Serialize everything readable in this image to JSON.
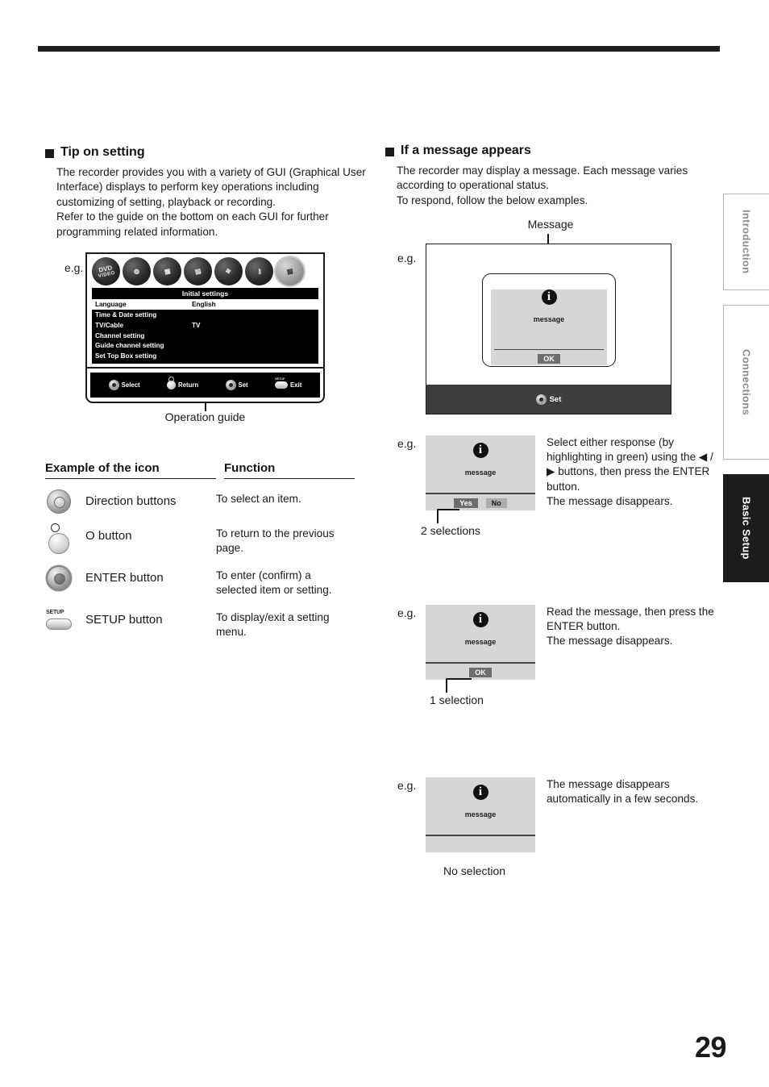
{
  "page": {
    "number": "29"
  },
  "side_tabs": [
    {
      "label": "Introduction",
      "active": false
    },
    {
      "label": "Connections",
      "active": false
    },
    {
      "label": "Basic Setup",
      "active": true
    }
  ],
  "left_column": {
    "heading": "Tip on setting",
    "paragraphs": [
      "The recorder provides you with a variety of GUI (Graphical User Interface) displays to perform key operations including customizing of setting, playback or recording.",
      "Refer to the guide on the bottom on each GUI for further programming related information."
    ],
    "eg_label": "e.g.",
    "gui": {
      "icons": [
        {
          "name": "dvd-video-icon",
          "glyph": "DVD",
          "sub": "VIDEO",
          "selected": false
        },
        {
          "name": "disc-icon",
          "glyph": "◉",
          "sub": "",
          "selected": false
        },
        {
          "name": "display-icon",
          "glyph": "▦",
          "sub": "",
          "selected": false
        },
        {
          "name": "recording-icon",
          "glyph": "▤",
          "sub": "",
          "selected": false
        },
        {
          "name": "playback-icon",
          "glyph": "✤",
          "sub": "",
          "selected": false
        },
        {
          "name": "lock-key-icon",
          "glyph": "⚷",
          "sub": "",
          "selected": false
        },
        {
          "name": "initial-settings-icon",
          "glyph": "▤",
          "sub": "",
          "selected": true
        }
      ],
      "menu_title": "Initial settings",
      "menu_rows": [
        {
          "label": "Language",
          "value": "English",
          "active": true
        },
        {
          "label": "Time & Date setting",
          "value": "",
          "active": false
        },
        {
          "label": "TV/Cable",
          "value": "TV",
          "active": false
        },
        {
          "label": "Channel setting",
          "value": "",
          "active": false
        },
        {
          "label": "Guide channel setting",
          "value": "",
          "active": false
        },
        {
          "label": "Set Top Box setting",
          "value": "",
          "active": false
        }
      ],
      "operation_guide": [
        {
          "icon": "dpad-icon",
          "label": "Select"
        },
        {
          "icon": "return-button-icon",
          "label": "Return"
        },
        {
          "icon": "dpad-icon",
          "label": "Set"
        },
        {
          "icon": "setup-button-icon",
          "label": "Exit"
        }
      ],
      "caption": "Operation guide"
    },
    "table": {
      "headers": [
        "Example of the icon",
        "Function"
      ],
      "rows": [
        {
          "icon": "direction-buttons-icon",
          "name": "Direction buttons",
          "function": "To select an item."
        },
        {
          "icon": "o-button-icon",
          "name": "O button",
          "function": "To return to the previous page."
        },
        {
          "icon": "enter-button-icon",
          "name": "ENTER button",
          "function": "To enter (confirm) a selected item or setting."
        },
        {
          "icon": "setup-button-icon",
          "name": "SETUP button",
          "function": "To display/exit a setting menu."
        }
      ]
    }
  },
  "right_column": {
    "heading": "If a message appears",
    "paragraphs": [
      "The recorder may display a message. Each message varies according to operational status.",
      "To respond, follow the below examples."
    ],
    "message_callout": "Message",
    "eg_label": "e.g.",
    "tv_example": {
      "info_icon": "i",
      "message": "message",
      "ok_button": "OK",
      "bottom_bar": {
        "icon": "dpad-icon",
        "label": "Set"
      }
    },
    "examples": [
      {
        "eg_label": "e.g.",
        "info_icon": "i",
        "message": "message",
        "buttons": [
          {
            "label": "Yes",
            "highlighted": true
          },
          {
            "label": "No",
            "highlighted": false
          }
        ],
        "caption": "2 selections",
        "text": "Select either response (by highlighting in green) using the ◀ / ▶ buttons, then press the ENTER button.\nThe message disappears."
      },
      {
        "eg_label": "e.g.",
        "info_icon": "i",
        "message": "message",
        "buttons": [
          {
            "label": "OK",
            "highlighted": true
          }
        ],
        "caption": "1 selection",
        "text": "Read the message, then press the ENTER button.\nThe message disappears."
      },
      {
        "eg_label": "e.g.",
        "info_icon": "i",
        "message": "message",
        "buttons": [],
        "caption": "No selection",
        "text": "The message disappears automatically in a few seconds."
      }
    ]
  }
}
